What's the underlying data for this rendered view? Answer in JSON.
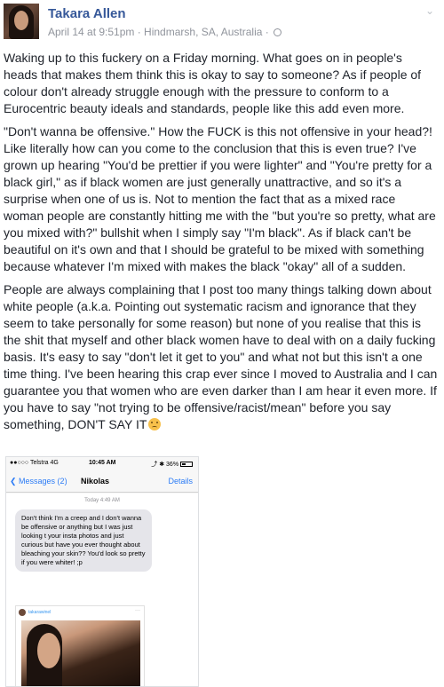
{
  "post": {
    "author": "Takara Allen",
    "meta": "April 14 at 9:51pm · Hindmarsh, SA, Australia ·",
    "paragraphs": [
      "Waking up to this fuckery on a Friday morning. What goes on in people's heads that makes them think this is okay to say to someone? As if people of colour don't already struggle enough with the pressure to conform to a Eurocentric beauty ideals and standards, people like this add even more.",
      "\"Don't wanna be offensive.\" How the FUCK is this not offensive in your head?! Like literally how can you come to the conclusion that this is even true? I've grown up hearing \"You'd be prettier if you were lighter\" and \"You're pretty for a black girl,\" as if black women are just generally unattractive, and so it's a surprise when one of us is. Not to mention the fact that as a mixed race woman people are constantly hitting me with the \"but you're so pretty, what are you mixed with?\" bullshit when I simply say \"I'm black\". As if black can't be beautiful on it's own and that I should be grateful to be mixed with something because whatever I'm mixed with makes the black \"okay\" all of a sudden.",
      "People are always complaining that I post too many things talking down about white people (a.k.a. Pointing out systematic racism and ignorance that they seem to take personally for some reason) but none of you realise that this is the shit that myself and other black women have to deal with on a daily fucking basis. It's easy to say \"don't let it get to you\" and what not but this isn't a one time thing. I've been hearing this crap ever since I moved to Australia and I can guarantee you that women who are even darker than I am hear it even more. If you have to say \"not trying to be offensive/racist/mean\" before you say something, DON'T SAY IT"
    ],
    "icons": {
      "privacy": "globe-icon",
      "menu": "chevron-down-icon",
      "reaction": "disappointed-face-emoji"
    }
  },
  "phone": {
    "carrier": "●●○○○ Telstra  4G",
    "time": "10:45 AM",
    "battery_text": "⤴ ✱ 36%",
    "back_label": "❮ Messages (2)",
    "contact": "Nikolas",
    "details_label": "Details",
    "timestamp": "Today 4:49 AM",
    "message": "Don't think I'm a creep and I don't wanna be offensive or anything but I was just looking t your insta photos and just curious but have you ever thought about bleaching your skin?? You'd look so pretty if you were whiter! ;p",
    "insta_user": "takarawinel",
    "insta_menu": "···"
  }
}
